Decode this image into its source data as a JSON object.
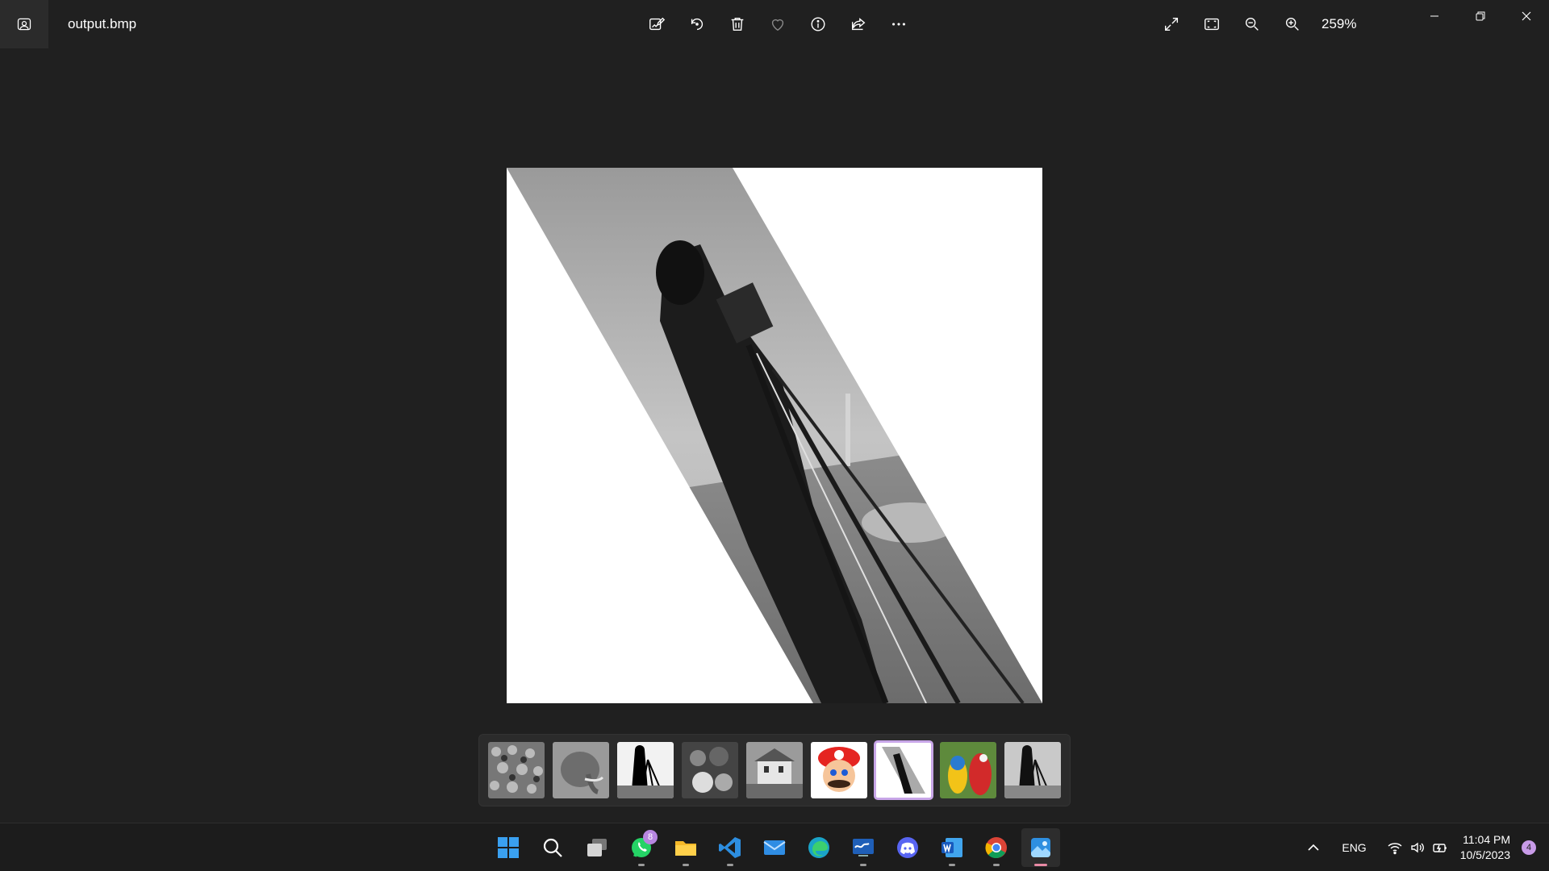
{
  "window": {
    "file_name": "output.bmp",
    "zoom_level": "259%"
  },
  "toolbar": {
    "items": [
      "edit-image",
      "rotate",
      "delete",
      "favorite",
      "file-info",
      "share",
      "more"
    ]
  },
  "right_tools": {
    "items": [
      "full-screen",
      "fit-to-window",
      "zoom-out",
      "zoom-in"
    ]
  },
  "filmstrip": {
    "items": [
      "crowd",
      "elephant",
      "cameraman",
      "fruits",
      "house",
      "mario",
      "output-sheared",
      "parrots",
      "cameraman-gray"
    ],
    "selected_index": 6
  },
  "taskbar": {
    "apps": [
      {
        "name": "start",
        "running": false
      },
      {
        "name": "search",
        "running": false
      },
      {
        "name": "task-view",
        "running": false
      },
      {
        "name": "whatsapp",
        "running": true,
        "badge": "8"
      },
      {
        "name": "file-explorer",
        "running": true
      },
      {
        "name": "vscode",
        "running": true
      },
      {
        "name": "mail",
        "running": false
      },
      {
        "name": "edge",
        "running": false
      },
      {
        "name": "terminal-app",
        "running": true
      },
      {
        "name": "discord",
        "running": false
      },
      {
        "name": "word",
        "running": true
      },
      {
        "name": "chrome",
        "running": true
      },
      {
        "name": "photos",
        "running": true,
        "active": true
      }
    ],
    "tray": {
      "language": "ENG",
      "time": "11:04 PM",
      "date": "10/5/2023",
      "notifications": "4"
    }
  },
  "colors": {
    "background": "#202020",
    "accent": "#c8a6e8",
    "badge": "#b786e0"
  }
}
